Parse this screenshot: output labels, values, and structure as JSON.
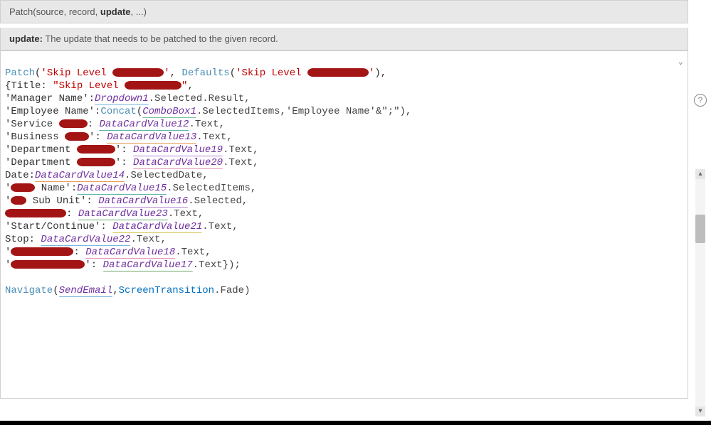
{
  "header": {
    "sig_prefix": "Patch(source, record, ",
    "sig_bold": "update",
    "sig_suffix": ", ...)",
    "desc_bold": "update:",
    "desc_text": " The update that needs to be patched to the given record."
  },
  "code": {
    "fn_patch": "Patch",
    "fn_defaults": "Defaults",
    "fn_concat": "Concat",
    "fn_navigate": "Navigate",
    "str_skip_level": "'Skip Level ",
    "str_skip_level2": "\"Skip Level ",
    "title_key": "{Title: ",
    "close_q1": "'",
    "close_q2": "\"",
    "manager_key": "'Manager Name':",
    "dropdown1": "Dropdown1",
    "selected_result": ".Selected.Result,",
    "employee_key": "'Employee Name':",
    "combobox1": "ComboBox1",
    "selecteditems_arg": ".SelectedItems,'Employee Name'&\";\"),",
    "service_key": "'Service ",
    "dc12": "DataCardValue12",
    "text_suffix": ".Text,",
    "business_key": "'Business ",
    "dc13": "DataCardValue13",
    "department_key": "'Department ",
    "dc19": "DataCardValue19",
    "dc20": "DataCardValue20",
    "date_key": "Date:",
    "dc14": "DataCardValue14",
    "selecteddate": ".SelectedDate,",
    "name_key": " Name':",
    "dc15": "DataCardValue15",
    "selecteditems": ".SelectedItems,",
    "subunit_key": " Sub Unit': ",
    "dc16": "DataCardValue16",
    "selected": ".Selected,",
    "dc23": "DataCardValue23",
    "startcont_key": "'Start/Continue': ",
    "dc21": "DataCardValue21",
    "stop_key": "Stop: ",
    "dc22": "DataCardValue22",
    "dc18": "DataCardValue18",
    "dc17": "DataCardValue17",
    "text_end": ".Text});",
    "sendemail": "SendEmail",
    "screentrans": "ScreenTransition",
    "fade": ".Fade)"
  },
  "icons": {
    "help": "?",
    "chevron": "⌄",
    "up": "▴",
    "down": "▾"
  }
}
